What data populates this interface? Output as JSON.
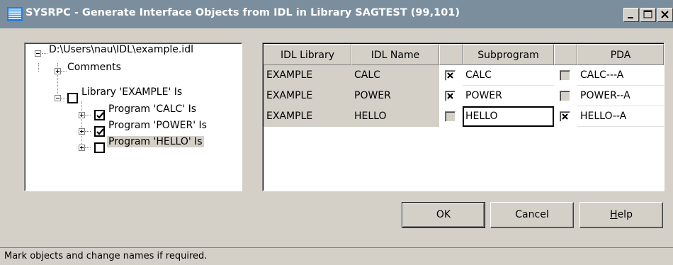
{
  "window": {
    "title": "SYSRPC - Generate Interface Objects from IDL in Library SAGTEST (99,101)",
    "titlebar_color": "#7b8e9e",
    "controls": {
      "minimize_icon": "minimize-icon",
      "maximize_icon": "maximize-icon",
      "close_icon": "close-icon"
    }
  },
  "tree": {
    "root": {
      "label": "D:\\Users\\nau\\IDL\\example.idl",
      "expander": "-"
    },
    "comments": {
      "label": "Comments",
      "expander": "+"
    },
    "library": {
      "label": "Library 'EXAMPLE' Is",
      "expander": "-",
      "checked": false
    },
    "programs": [
      {
        "label": "Program 'CALC' Is",
        "expander": "+",
        "checked": true
      },
      {
        "label": "Program 'POWER' Is",
        "expander": "+",
        "checked": true
      },
      {
        "label": "Program 'HELLO' Is",
        "expander": "+",
        "checked": false,
        "selected": true
      }
    ]
  },
  "grid": {
    "headers": {
      "idl_library": "IDL Library",
      "idl_name": "IDL Name",
      "check1": "",
      "subprogram": "Subprogram",
      "check2": "",
      "pda": "PDA"
    },
    "rows": [
      {
        "idl_library": "EXAMPLE",
        "idl_name": "CALC",
        "sub_checked": true,
        "subprogram": "CALC",
        "pda_checked": false,
        "pda": "CALC---A"
      },
      {
        "idl_library": "EXAMPLE",
        "idl_name": "POWER",
        "sub_checked": true,
        "subprogram": "POWER",
        "pda_checked": false,
        "pda": "POWER--A"
      },
      {
        "idl_library": "EXAMPLE",
        "idl_name": "HELLO",
        "sub_checked": false,
        "subprogram": "HELLO",
        "pda_checked": true,
        "pda": "HELLO--A"
      }
    ]
  },
  "buttons": {
    "ok": "OK",
    "cancel": "Cancel",
    "help_prefix": "",
    "help_mnemonic": "H",
    "help_rest": "elp"
  },
  "status": {
    "text": "Mark objects and change names if required."
  }
}
